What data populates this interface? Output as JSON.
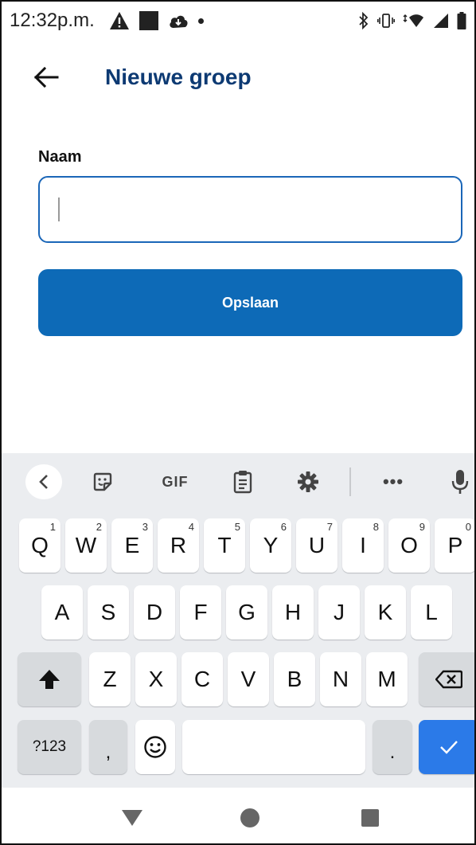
{
  "status_bar": {
    "time": "12:32p.m.",
    "left_icons": [
      "warning-icon",
      "square-icon",
      "cloud-download-icon",
      "dot-icon"
    ],
    "right_icons": [
      "bluetooth-icon",
      "vibrate-icon",
      "wifi-icon",
      "signal-icon",
      "battery-icon"
    ]
  },
  "app_bar": {
    "title": "Nieuwe groep"
  },
  "form": {
    "name_label": "Naam",
    "name_value": "",
    "save_label": "Opslaan"
  },
  "keyboard": {
    "toolbar": {
      "gif_label": "GIF",
      "more_label": "•••"
    },
    "row1": [
      {
        "key": "Q",
        "hint": "1"
      },
      {
        "key": "W",
        "hint": "2"
      },
      {
        "key": "E",
        "hint": "3"
      },
      {
        "key": "R",
        "hint": "4"
      },
      {
        "key": "T",
        "hint": "5"
      },
      {
        "key": "Y",
        "hint": "6"
      },
      {
        "key": "U",
        "hint": "7"
      },
      {
        "key": "I",
        "hint": "8"
      },
      {
        "key": "O",
        "hint": "9"
      },
      {
        "key": "P",
        "hint": "0"
      }
    ],
    "row2": [
      "A",
      "S",
      "D",
      "F",
      "G",
      "H",
      "J",
      "K",
      "L"
    ],
    "row3": [
      "Z",
      "X",
      "C",
      "V",
      "B",
      "N",
      "M"
    ],
    "row4": {
      "symbols_label": "?123",
      "comma_label": ",",
      "period_label": "."
    }
  },
  "colors": {
    "title": "#0d3a73",
    "primary_button": "#0d6ab7",
    "input_border": "#1a66b8",
    "done_key": "#2b7ae8"
  }
}
